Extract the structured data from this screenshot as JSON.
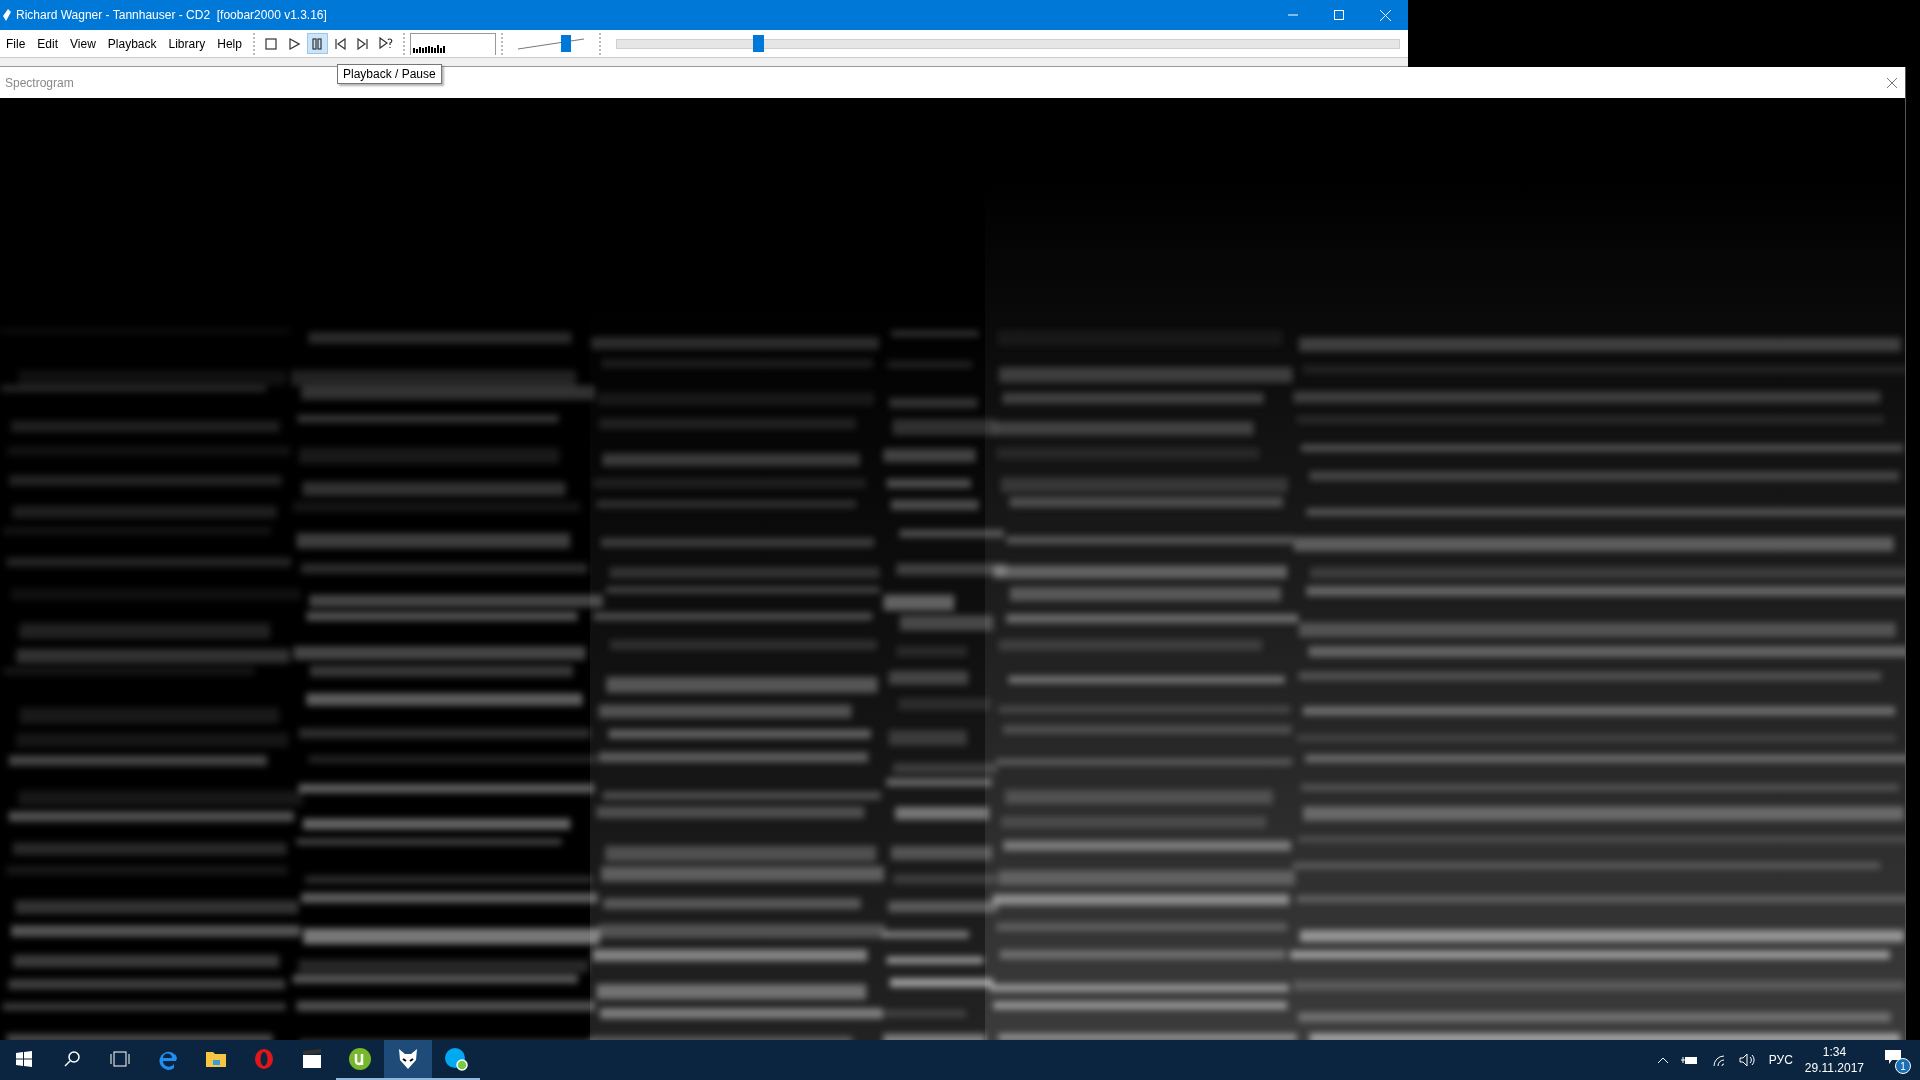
{
  "window": {
    "title": "Richard Wagner - Tannhauser - CD2  [foobar2000 v1.3.16]"
  },
  "menu": [
    "File",
    "Edit",
    "View",
    "Playback",
    "Library",
    "Help"
  ],
  "toolbar": [
    {
      "kind": "stop",
      "hovered": false
    },
    {
      "kind": "play",
      "hovered": false
    },
    {
      "kind": "pause",
      "hovered": true
    },
    {
      "kind": "prev",
      "hovered": false
    },
    {
      "kind": "next",
      "hovered": false
    },
    {
      "kind": "random",
      "hovered": false
    }
  ],
  "volume": {
    "level": 0.72
  },
  "seekbar": {
    "level": 0.18
  },
  "tooltip": "Playback / Pause",
  "panel": {
    "title": "Spectrogram"
  },
  "taskbar": {
    "apps": [
      {
        "kind": "edge",
        "running": false,
        "active": false
      },
      {
        "kind": "explorer",
        "running": false,
        "active": false
      },
      {
        "kind": "opera",
        "running": false,
        "active": false
      },
      {
        "kind": "mpc",
        "running": false,
        "active": false
      },
      {
        "kind": "torrent",
        "running": true,
        "active": false
      },
      {
        "kind": "foobar",
        "running": true,
        "active": true
      },
      {
        "kind": "skype",
        "running": true,
        "active": false
      }
    ],
    "language": "РУС",
    "time": "1:34",
    "date": "29.11.2017",
    "notifications": "1"
  }
}
